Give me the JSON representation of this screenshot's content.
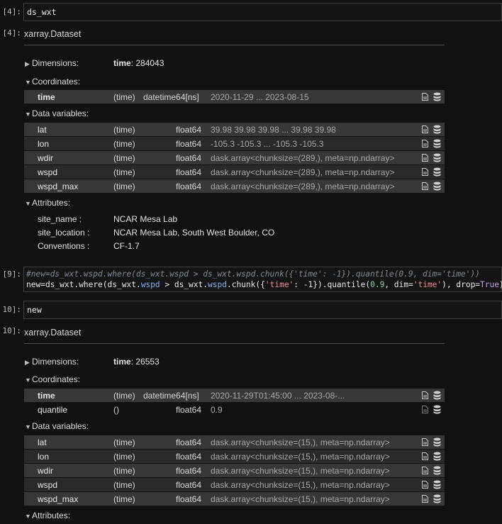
{
  "cell4": {
    "in_prompt": "[4]:",
    "code": "ds_wxt",
    "out_prompt": "[4]:",
    "dataset_title": "xarray.Dataset",
    "dimensions_label": "Dimensions:",
    "dimensions_value_name": "time",
    "dimensions_value_count": ": 284043",
    "coordinates_label": "Coordinates:",
    "coordinates": [
      {
        "name": "time",
        "dims": "(time)",
        "dtype": "datetime64[ns]",
        "preview": "2020-11-29 ... 2023-08-15"
      }
    ],
    "data_vars_label": "Data variables:",
    "data_vars": [
      {
        "name": "lat",
        "dims": "(time)",
        "dtype": "float64",
        "preview": "39.98 39.98 39.98 ... 39.98 39.98"
      },
      {
        "name": "lon",
        "dims": "(time)",
        "dtype": "float64",
        "preview": "-105.3 -105.3 ... -105.3 -105.3"
      },
      {
        "name": "wdir",
        "dims": "(time)",
        "dtype": "float64",
        "preview": "dask.array<chunksize=(289,), meta=np.ndarray>"
      },
      {
        "name": "wspd",
        "dims": "(time)",
        "dtype": "float64",
        "preview": "dask.array<chunksize=(289,), meta=np.ndarray>"
      },
      {
        "name": "wspd_max",
        "dims": "(time)",
        "dtype": "float64",
        "preview": "dask.array<chunksize=(289,), meta=np.ndarray>"
      }
    ],
    "attributes_label": "Attributes:",
    "attributes": [
      {
        "key": "site_name :",
        "value": "NCAR Mesa Lab"
      },
      {
        "key": "site_location :",
        "value": "NCAR Mesa Lab, South West Boulder, CO"
      },
      {
        "key": "Conventions :",
        "value": "CF-1.7"
      }
    ]
  },
  "cell9": {
    "in_prompt": "[9]:",
    "line1": "#new=ds_wxt.wspd.where(ds_wxt.wspd > ds_wxt.wspd.chunk({'time': -1}).quantile(0.9, dim='time'))",
    "line2_a": "new",
    "line2_b": "=ds_wxt.",
    "line2_c": "where",
    "line2_d": "(ds_wxt.",
    "line2_e": "wspd",
    "line2_f": " > ds_wxt.",
    "line2_g": "wspd",
    "line2_h": ".",
    "line2_i": "chunk",
    "line2_j": "({",
    "line2_k": "'time'",
    "line2_l": ": -1}).",
    "line2_m": "quantile",
    "line2_n": "(",
    "line2_o": "0.9",
    "line2_p": ", dim=",
    "line2_q": "'time'",
    "line2_r": "), drop=",
    "line2_s": "True",
    "line2_t": ")"
  },
  "cell10": {
    "in_prompt": "10]:",
    "code": "new",
    "out_prompt": "10]:",
    "dataset_title": "xarray.Dataset",
    "dimensions_label": "Dimensions:",
    "dimensions_value_name": "time",
    "dimensions_value_count": ": 26553",
    "coordinates_label": "Coordinates:",
    "coordinates": [
      {
        "name": "time",
        "dims": "(time)",
        "dtype": "datetime64[ns]",
        "preview": "2020-11-29T01:45:00 ... 2023-08-..."
      },
      {
        "name": "quantile",
        "dims": "()",
        "dtype": "float64",
        "preview": "0.9"
      }
    ],
    "data_vars_label": "Data variables:",
    "data_vars": [
      {
        "name": "lat",
        "dims": "(time)",
        "dtype": "float64",
        "preview": "dask.array<chunksize=(15,), meta=np.ndarray>"
      },
      {
        "name": "lon",
        "dims": "(time)",
        "dtype": "float64",
        "preview": "dask.array<chunksize=(15,), meta=np.ndarray>"
      },
      {
        "name": "wdir",
        "dims": "(time)",
        "dtype": "float64",
        "preview": "dask.array<chunksize=(15,), meta=np.ndarray>"
      },
      {
        "name": "wspd",
        "dims": "(time)",
        "dtype": "float64",
        "preview": "dask.array<chunksize=(15,), meta=np.ndarray>"
      },
      {
        "name": "wspd_max",
        "dims": "(time)",
        "dtype": "float64",
        "preview": "dask.array<chunksize=(15,), meta=np.ndarray>"
      }
    ],
    "attributes_label": "Attributes:"
  },
  "icons": {
    "attrs": "file-icon",
    "data": "database-icon"
  }
}
